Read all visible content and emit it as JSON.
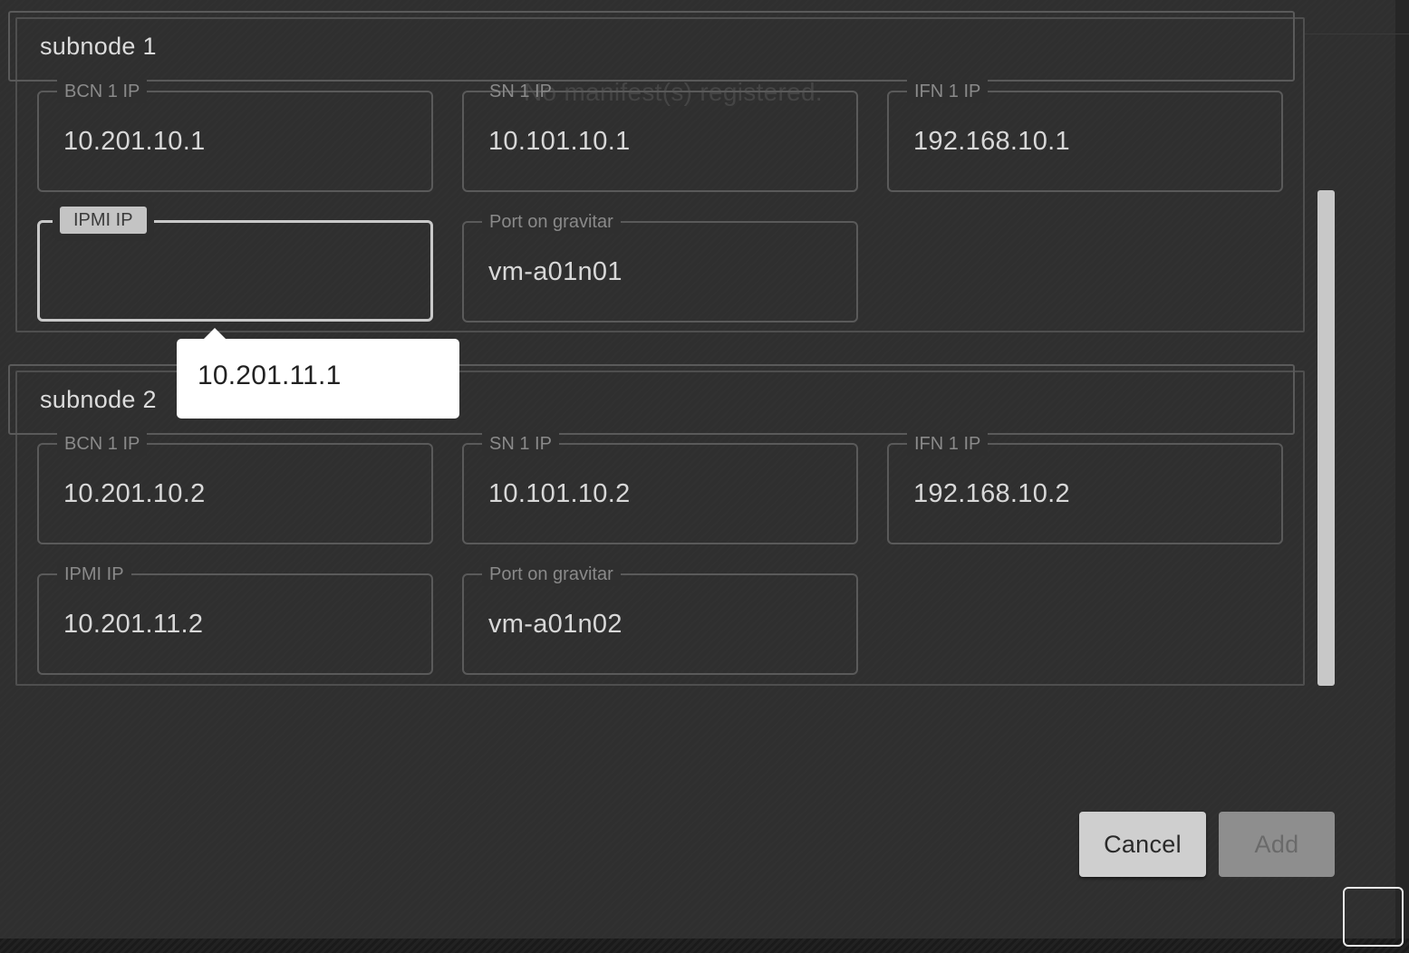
{
  "empty_message": "No manifest(s) registered.",
  "subnodes": [
    {
      "title": "subnode 1",
      "bcn1": {
        "label": "BCN 1 IP",
        "value": "10.201.10.1"
      },
      "sn1": {
        "label": "SN 1 IP",
        "value": "10.101.10.1"
      },
      "ifn1": {
        "label": "IFN 1 IP",
        "value": "192.168.10.1"
      },
      "ipmi": {
        "label": "IPMI IP",
        "value": ""
      },
      "port": {
        "label": "Port on gravitar",
        "value": "vm-a01n01"
      }
    },
    {
      "title": "subnode 2",
      "bcn1": {
        "label": "BCN 1 IP",
        "value": "10.201.10.2"
      },
      "sn1": {
        "label": "SN 1 IP",
        "value": "10.101.10.2"
      },
      "ifn1": {
        "label": "IFN 1 IP",
        "value": "192.168.10.2"
      },
      "ipmi": {
        "label": "IPMI IP",
        "value": "10.201.11.2"
      },
      "port": {
        "label": "Port on gravitar",
        "value": "vm-a01n02"
      }
    }
  ],
  "tooltip": {
    "text": "10.201.11.1"
  },
  "actions": {
    "cancel_label": "Cancel",
    "add_label": "Add"
  }
}
